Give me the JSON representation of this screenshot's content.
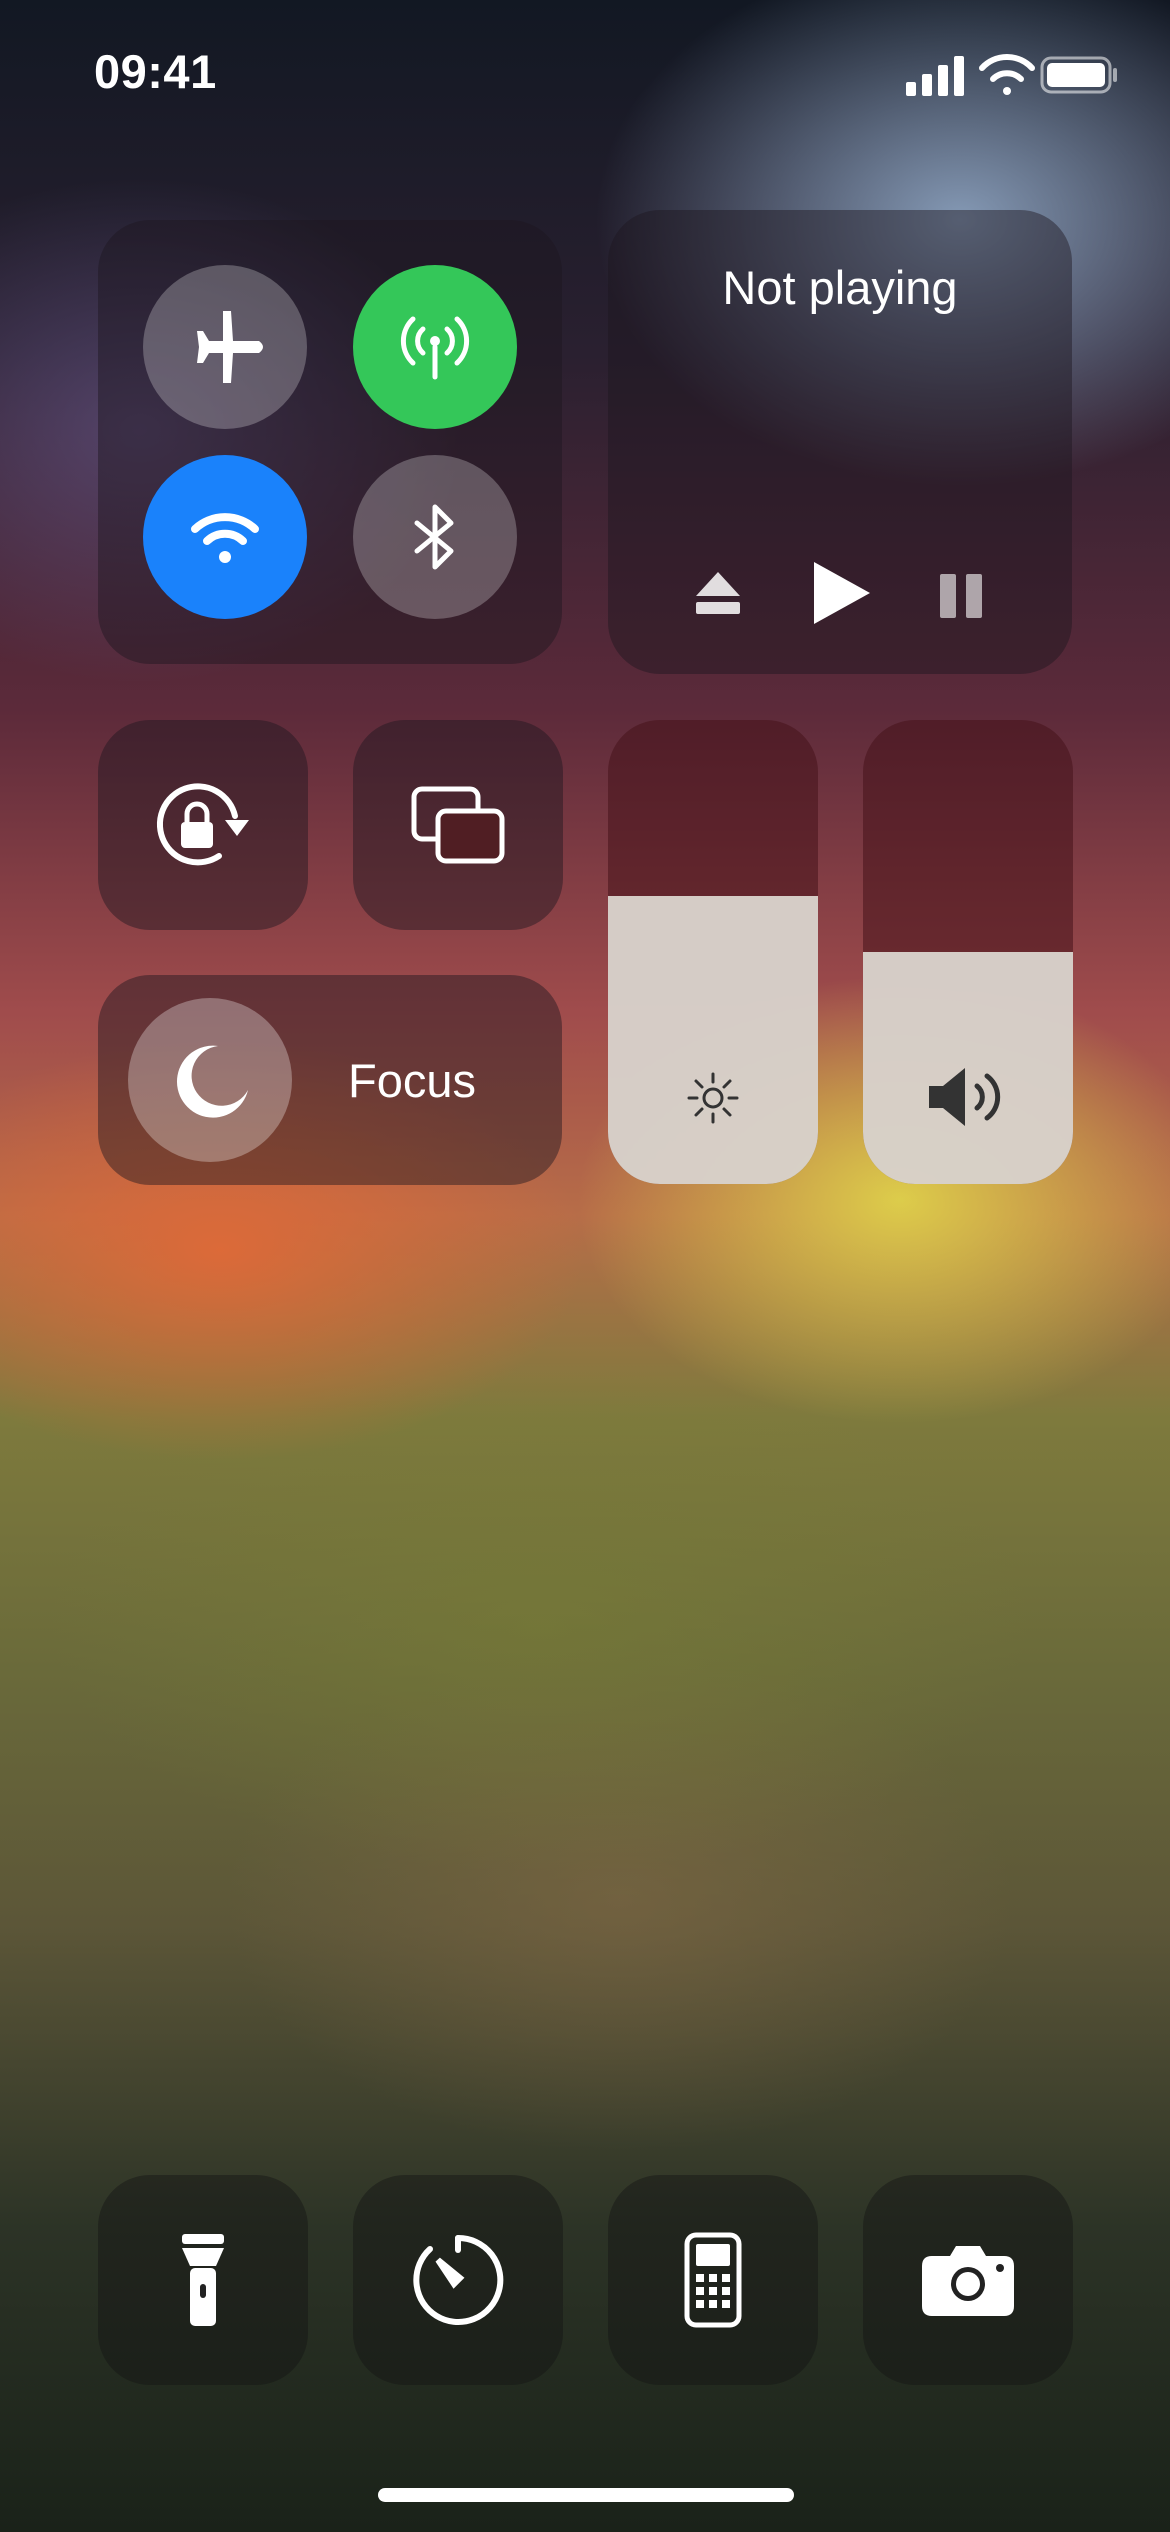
{
  "status_bar": {
    "time": "09:41",
    "signal_icon": "cellular-signal-icon",
    "wifi_icon": "wifi-icon",
    "battery_icon": "battery-icon"
  },
  "connectivity": {
    "airplane": {
      "icon": "airplane-icon",
      "active": false
    },
    "cellular": {
      "icon": "cellular-antenna-icon",
      "active": true,
      "color": "#34c759"
    },
    "wifi": {
      "icon": "wifi-icon",
      "active": true,
      "color": "#1a82fb"
    },
    "bluetooth": {
      "icon": "bluetooth-icon",
      "active": false
    }
  },
  "now_playing": {
    "title": "Not playing",
    "controls": [
      "eject-icon",
      "play-icon",
      "pause-icon"
    ]
  },
  "toggles": {
    "rotation_lock": "rotation-lock-icon",
    "screen_mirroring": "screen-mirroring-icon"
  },
  "focus": {
    "label": "Focus",
    "icon": "moon-icon"
  },
  "brightness": {
    "level": 0.62,
    "icon": "sun-icon"
  },
  "volume": {
    "level": 0.5,
    "icon": "speaker-icon"
  },
  "shortcuts": [
    "flashlight-icon",
    "timer-icon",
    "calculator-icon",
    "camera-icon"
  ]
}
